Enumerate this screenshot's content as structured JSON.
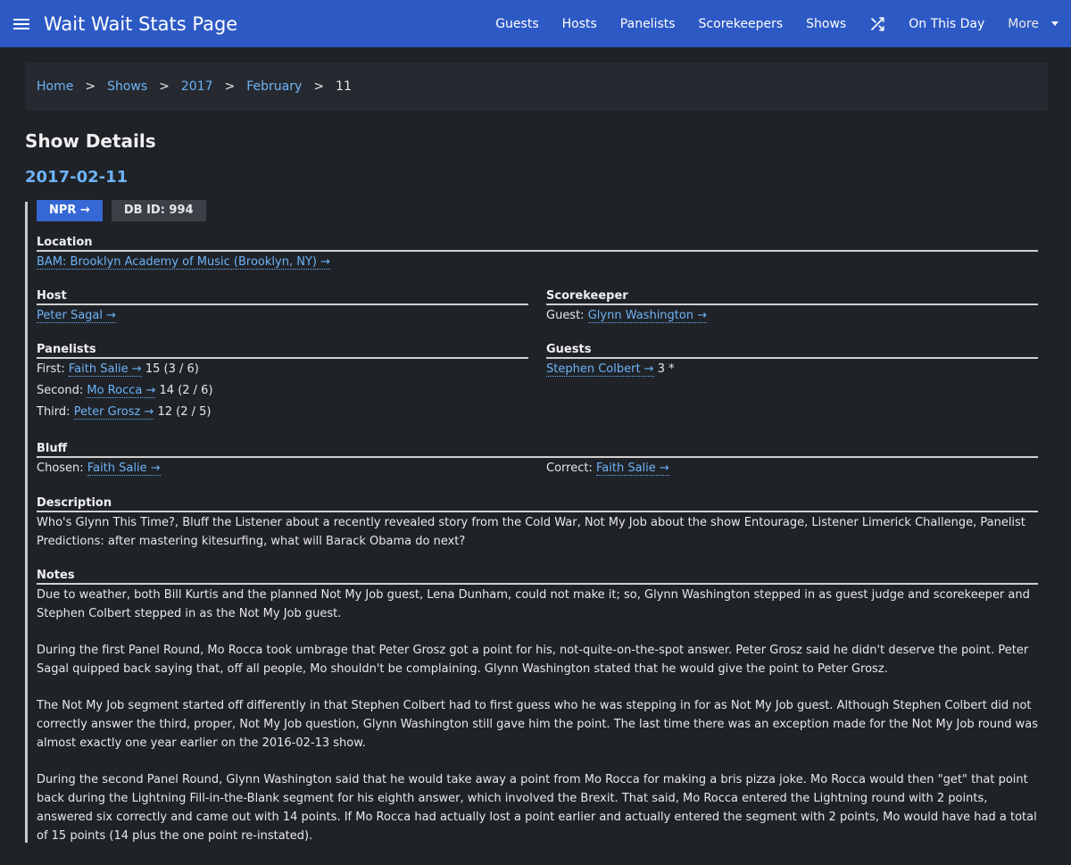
{
  "nav": {
    "brand": "Wait Wait Stats Page",
    "links": [
      "Guests",
      "Hosts",
      "Panelists",
      "Scorekeepers",
      "Shows"
    ],
    "on_this_day": "On This Day",
    "more": "More"
  },
  "breadcrumb": {
    "items": [
      "Home",
      "Shows",
      "2017",
      "February"
    ],
    "current": "11",
    "separator": ">"
  },
  "page_title": "Show Details",
  "show_date": "2017-02-11",
  "badges": {
    "npr": "NPR →",
    "db_id": "DB ID: 994"
  },
  "location": {
    "label": "Location",
    "value": "BAM: Brooklyn Academy of Music (Brooklyn, NY) →"
  },
  "host": {
    "label": "Host",
    "value": "Peter Sagal →"
  },
  "scorekeeper": {
    "label": "Scorekeeper",
    "prefix": "Guest:",
    "value": "Glynn Washington →"
  },
  "panelists": {
    "label": "Panelists",
    "items": [
      {
        "position": "First:",
        "name": "Faith Salie →",
        "score": "15 (3 / 6)"
      },
      {
        "position": "Second:",
        "name": "Mo Rocca →",
        "score": "14 (2 / 6)"
      },
      {
        "position": "Third:",
        "name": "Peter Grosz →",
        "score": "12 (2 / 5)"
      }
    ]
  },
  "guests": {
    "label": "Guests",
    "name": "Stephen Colbert →",
    "score": "3 *"
  },
  "bluff": {
    "label": "Bluff",
    "chosen_prefix": "Chosen:",
    "chosen": "Faith Salie →",
    "correct_prefix": "Correct:",
    "correct": "Faith Salie →"
  },
  "description": {
    "label": "Description",
    "text": "Who's Glynn This Time?, Bluff the Listener about a recently revealed story from the Cold War, Not My Job about the show Entourage, Listener Limerick Challenge, Panelist Predictions: after mastering kitesurfing, what will Barack Obama do next?"
  },
  "notes": {
    "label": "Notes",
    "paragraphs": [
      "Due to weather, both Bill Kurtis and the planned Not My Job guest, Lena Dunham, could not make it; so, Glynn Washington stepped in as guest judge and scorekeeper and Stephen Colbert stepped in as the Not My Job guest.",
      "During the first Panel Round, Mo Rocca took umbrage that Peter Grosz got a point for his, not-quite-on-the-spot answer. Peter Grosz said he didn't deserve the point. Peter Sagal quipped back saying that, off all people, Mo shouldn't be complaining. Glynn Washington stated that he would give the point to Peter Grosz.",
      "The Not My Job segment started off differently in that Stephen Colbert had to first guess who he was stepping in for as Not My Job guest. Although Stephen Colbert did not correctly answer the third, proper, Not My Job question, Glynn Washington still gave him the point. The last time there was an exception made for the Not My Job round was almost exactly one year earlier on the 2016-02-13 show.",
      "During the second Panel Round, Glynn Washington said that he would take away a point from Mo Rocca for making a bris pizza joke. Mo Rocca would then \"get\" that point back during the Lightning Fill-in-the-Blank segment for his eighth answer, which involved the Brexit. That said, Mo Rocca entered the Lightning round with 2 points, answered six correctly and came out with 14 points. If Mo Rocca had actually lost a point earlier and actually entered the segment with 2 points, Mo would have had a total of 15 points (14 plus the one point re-instated)."
    ]
  },
  "colors": {
    "navbar": "#2d59c4",
    "background": "#1f2227",
    "link": "#6eb3f7",
    "badge_npr": "#3568d4"
  }
}
